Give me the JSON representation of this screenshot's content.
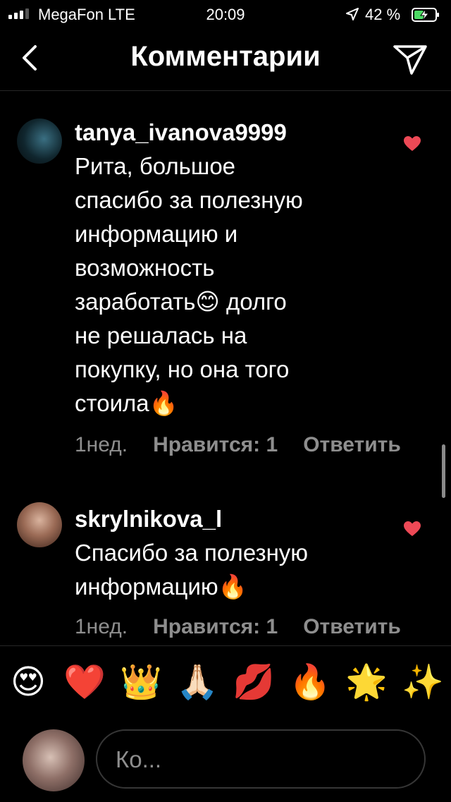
{
  "status_bar": {
    "carrier": "MegaFon LTE",
    "time": "20:09",
    "battery_percent": "42 %"
  },
  "header": {
    "title": "Комментарии",
    "back_icon": "chevron-left-icon",
    "send_icon": "paper-plane-icon"
  },
  "comments": [
    {
      "username": "tanya_ivanova9999",
      "text": "Рита, большое\nспасибо за полезную\nинформацию и\nвозможность\nзаработать😊 долго\nне решалась на\nпокупку, но она того\nстоила🔥",
      "time": "1нед.",
      "likes": "Нравится: 1",
      "reply": "Ответить",
      "liked": true
    },
    {
      "username": "skrylnikova_l",
      "text": "Спасибо за полезную\nинформацию🔥",
      "time": "1нед.",
      "likes": "Нравится: 1",
      "reply": "Ответить",
      "liked": true
    }
  ],
  "quick_emojis": [
    "😍",
    "❤️",
    "👑",
    "🙏🏻",
    "💋",
    "🔥",
    "🌟",
    "✨"
  ],
  "composer": {
    "placeholder": "Ко..."
  },
  "colors": {
    "background": "#000000",
    "secondary_text": "#8e8e8e",
    "heart": "#ed4956",
    "battery_fill": "#4cd964"
  }
}
